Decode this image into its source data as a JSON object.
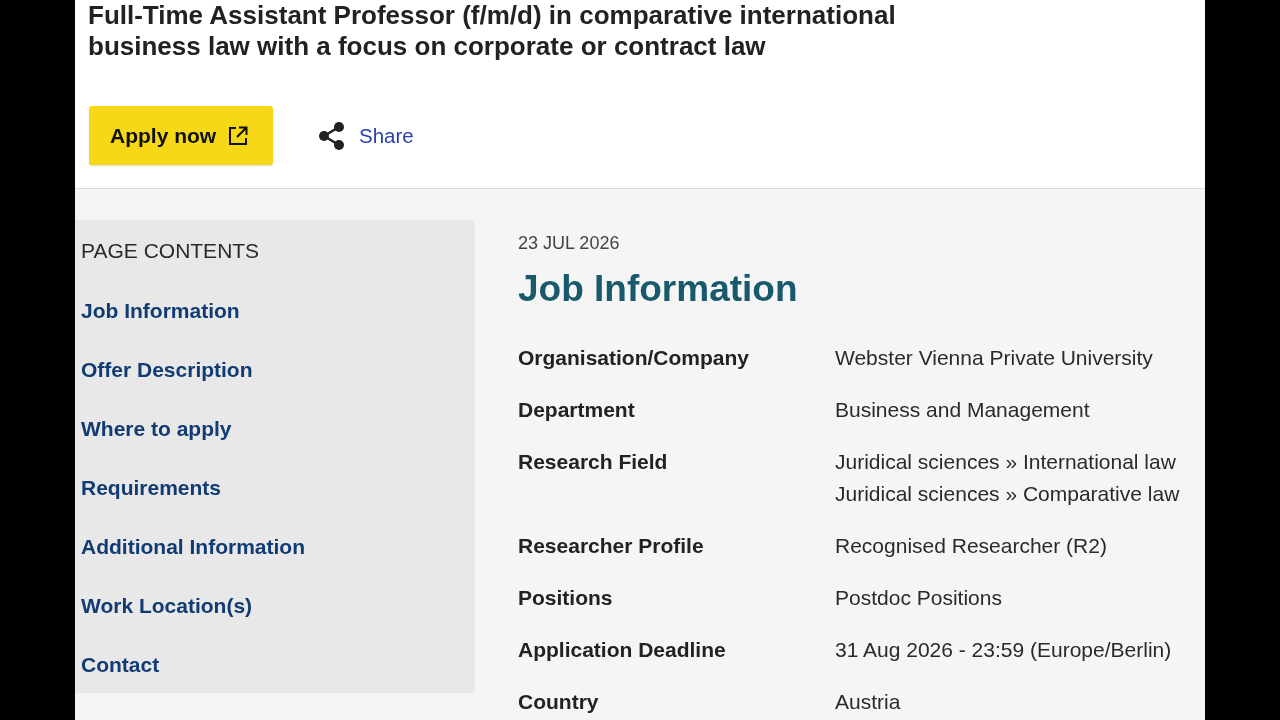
{
  "job_title": "Full-Time Assistant Professor (f/m/d) in comparative international business law with a focus on corporate or contract law",
  "actions": {
    "apply_button": "Apply now",
    "share_link": "Share"
  },
  "page_contents": {
    "title": "PAGE CONTENTS",
    "items": [
      "Job Information",
      "Offer Description",
      "Where to apply",
      "Requirements",
      "Additional Information",
      "Work Location(s)",
      "Contact"
    ]
  },
  "job_information": {
    "date": "23 JUL 2026",
    "heading": "Job Information",
    "rows": [
      {
        "label": "Organisation/Company",
        "values": [
          "Webster Vienna Private University"
        ]
      },
      {
        "label": "Department",
        "values": [
          "Business and Management"
        ]
      },
      {
        "label": "Research Field",
        "values": [
          "Juridical sciences » International law",
          "Juridical sciences » Comparative law"
        ]
      },
      {
        "label": "Researcher Profile",
        "values": [
          "Recognised Researcher (R2)"
        ]
      },
      {
        "label": "Positions",
        "values": [
          "Postdoc Positions"
        ]
      },
      {
        "label": "Application Deadline",
        "values": [
          "31 Aug 2026 - 23:59 (Europe/Berlin)"
        ]
      },
      {
        "label": "Country",
        "values": [
          "Austria"
        ]
      }
    ]
  }
}
